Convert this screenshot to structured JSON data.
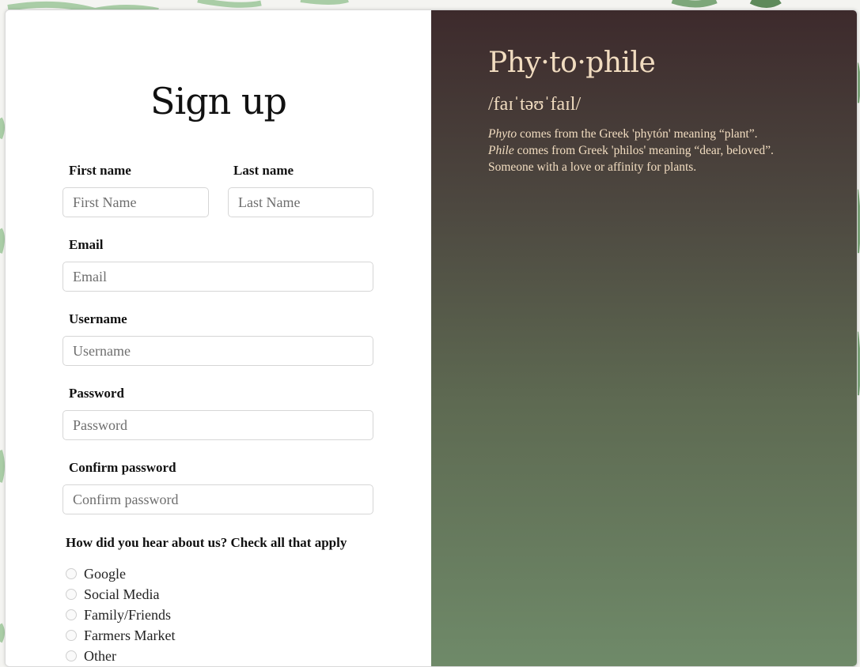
{
  "colors": {
    "accent_text": "#f1dcc0",
    "panel_top": "#3d2a2c",
    "panel_bottom": "#6f8a69",
    "leaf": "#8fb88f"
  },
  "form": {
    "title": "Sign up",
    "fields": {
      "first_name": {
        "label": "First name",
        "placeholder": "First Name",
        "value": ""
      },
      "last_name": {
        "label": "Last name",
        "placeholder": "Last Name",
        "value": ""
      },
      "email": {
        "label": "Email",
        "placeholder": "Email",
        "value": ""
      },
      "username": {
        "label": "Username",
        "placeholder": "Username",
        "value": ""
      },
      "password": {
        "label": "Password",
        "placeholder": "Password",
        "value": ""
      },
      "confirm_password": {
        "label": "Confirm password",
        "placeholder": "Confirm password",
        "value": ""
      }
    },
    "question": "How did you hear about us? Check all that apply",
    "options": [
      {
        "label": "Google",
        "checked": false
      },
      {
        "label": "Social Media",
        "checked": false
      },
      {
        "label": "Family/Friends",
        "checked": false
      },
      {
        "label": "Farmers Market",
        "checked": false
      },
      {
        "label": "Other",
        "checked": false
      }
    ]
  },
  "definition": {
    "word": "Phy·to·phile",
    "pronunciation": "/faɪˈtəʊˈfaɪl/",
    "line1_term": "Phyto",
    "line1_rest": " comes from the Greek 'phytón' meaning “plant”.",
    "line2_term": "Phile",
    "line2_rest": " comes from Greek 'philos' meaning “dear, beloved”.",
    "line3": "Someone with a love or affinity for plants."
  }
}
